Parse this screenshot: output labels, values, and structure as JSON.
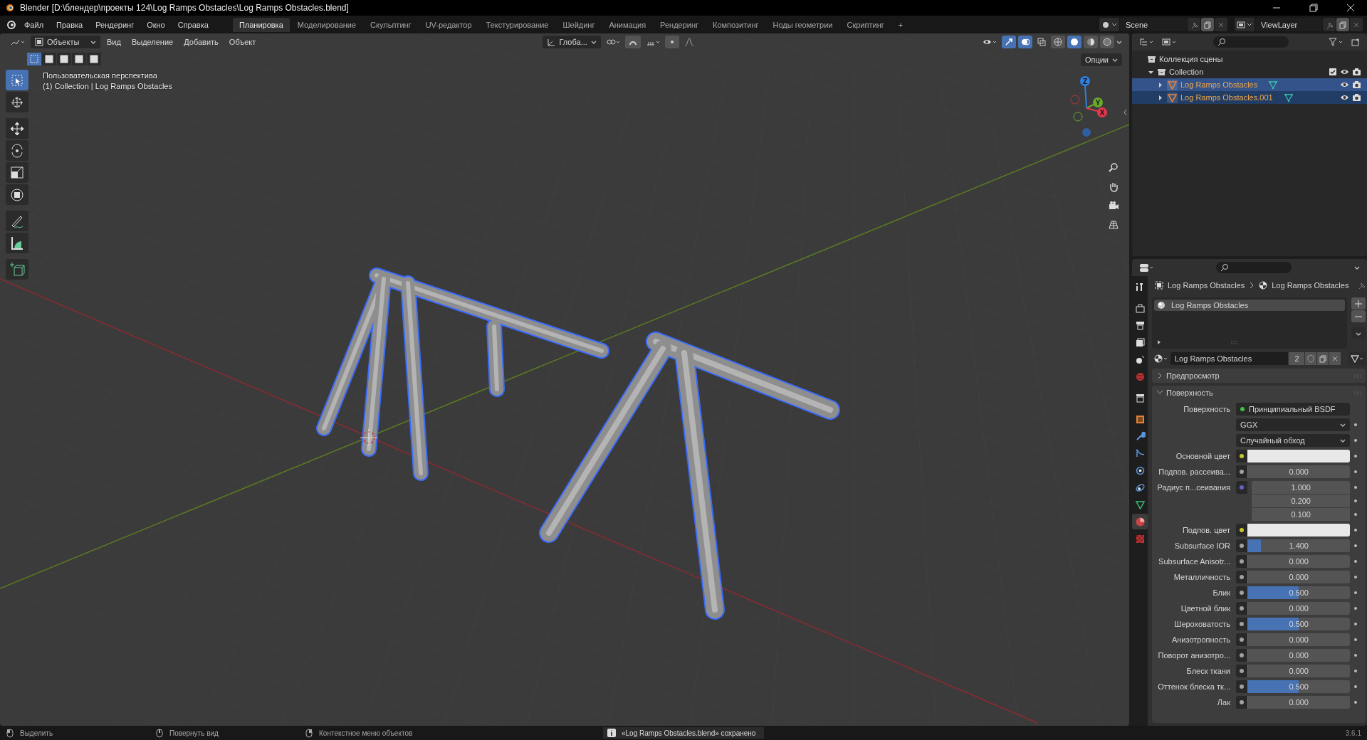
{
  "window": {
    "title": "Blender [D:\\блендер\\проекты 124\\Log Ramps Obstacles\\Log Ramps Obstacles.blend]"
  },
  "menu": [
    "Файл",
    "Правка",
    "Рендеринг",
    "Окно",
    "Справка"
  ],
  "workspace_tabs": [
    {
      "label": "Планировка",
      "selected": true
    },
    {
      "label": "Моделирование",
      "selected": false
    },
    {
      "label": "Скульптинг",
      "selected": false
    },
    {
      "label": "UV-редактор",
      "selected": false
    },
    {
      "label": "Текстурирование",
      "selected": false
    },
    {
      "label": "Шейдинг",
      "selected": false
    },
    {
      "label": "Анимация",
      "selected": false
    },
    {
      "label": "Рендеринг",
      "selected": false
    },
    {
      "label": "Композитинг",
      "selected": false
    },
    {
      "label": "Ноды геометрии",
      "selected": false
    },
    {
      "label": "Скриптинг",
      "selected": false
    }
  ],
  "add_tab": "+",
  "scene": {
    "scene_name": "Scene",
    "view_layer": "ViewLayer"
  },
  "viewport": {
    "mode": "Объекты",
    "menus": [
      "Вид",
      "Выделение",
      "Добавить",
      "Объект"
    ],
    "orientation": "Глоба...",
    "options": "Опции",
    "view_name": "Пользовательская перспектива",
    "object_info": "(1) Collection | Log Ramps Obstacles",
    "select_modes": [
      {
        "selected": true
      },
      {
        "selected": false
      },
      {
        "selected": false
      },
      {
        "selected": false
      },
      {
        "selected": false
      }
    ],
    "tools": [
      {
        "kind": "select",
        "selected": true
      },
      {
        "kind": "cursor",
        "selected": false
      },
      {
        "kind": "move",
        "selected": false
      },
      {
        "kind": "rotate",
        "selected": false
      },
      {
        "kind": "scale",
        "selected": false
      },
      {
        "kind": "transform",
        "selected": false
      },
      {
        "kind": "annotate",
        "selected": false
      },
      {
        "kind": "measure",
        "selected": false
      },
      {
        "kind": "add_cube",
        "selected": false
      }
    ],
    "gizmo_axes": [
      {
        "label": "Z",
        "color": "#2f7fe0"
      },
      {
        "label": "Y",
        "color": "#6aa82c"
      },
      {
        "label": "X",
        "color": "#e0384f"
      }
    ]
  },
  "outliner": {
    "tree": [
      {
        "label": "Коллекция сцены",
        "kind": "scene",
        "selected": false,
        "children": [
          {
            "label": "Collection",
            "kind": "collection",
            "selected": false,
            "expanded": true,
            "checked": true,
            "children": [
              {
                "label": "Log Ramps Obstacles",
                "kind": "mesh",
                "selected": true,
                "active": true,
                "expanded": false
              },
              {
                "label": "Log Ramps Obstacles.001",
                "kind": "mesh",
                "selected": true,
                "active": false,
                "expanded": false
              }
            ]
          }
        ]
      }
    ]
  },
  "properties": {
    "tabs": [
      {
        "kind": "tool",
        "selected": false
      },
      {
        "kind": "render",
        "selected": false
      },
      {
        "kind": "output",
        "selected": false
      },
      {
        "kind": "view_layer",
        "selected": false
      },
      {
        "kind": "scene",
        "selected": false
      },
      {
        "kind": "world",
        "selected": false
      },
      {
        "kind": "collection",
        "selected": false
      },
      {
        "kind": "object",
        "selected": false
      },
      {
        "kind": "modifier",
        "selected": false
      },
      {
        "kind": "particles",
        "selected": false
      },
      {
        "kind": "physics",
        "selected": false
      },
      {
        "kind": "constraints",
        "selected": false
      },
      {
        "kind": "data",
        "selected": false
      },
      {
        "kind": "material",
        "selected": true
      },
      {
        "kind": "texture",
        "selected": false
      }
    ],
    "breadcrumb": [
      "Log Ramps Obstacles",
      "Log Ramps Obstacles"
    ],
    "material_slots": [
      {
        "name": "Log Ramps Obstacles",
        "selected": true
      }
    ],
    "material": {
      "name": "Log Ramps Obstacles",
      "users": "2"
    },
    "panels": [
      {
        "title": "Предпросмотр",
        "expanded": false
      },
      {
        "title": "Поверхность",
        "expanded": true
      }
    ],
    "rows": [
      {
        "kind": "shader",
        "label": "Поверхность",
        "value": "Принципиальный BSDF",
        "socket": {
          "color": "#3fc03f"
        }
      },
      {
        "kind": "dropdown",
        "value": "GGX"
      },
      {
        "kind": "dropdown",
        "value": "Случайный обход"
      },
      {
        "kind": "color",
        "label": "Основной цвет",
        "color": "#e8e8e8",
        "socket": {
          "color": "#c7c729"
        }
      },
      {
        "kind": "value",
        "label": "Подпов. рассеива...",
        "value": "0.000",
        "level": 0,
        "socket": {
          "color": "#a1a1a1"
        }
      },
      {
        "kind": "vector",
        "label": "Радиус п...сеивания",
        "values": [
          "1.000",
          "0.200",
          "0.100"
        ],
        "socket": {
          "color": "#6363c7"
        }
      },
      {
        "kind": "color",
        "label": "Подпов. цвет",
        "color": "#e8e8e8",
        "socket": {
          "color": "#c7c729"
        }
      },
      {
        "kind": "value",
        "label": "Subsurface IOR",
        "value": "1.400",
        "level": 0.13,
        "socket": {
          "color": "#a1a1a1"
        }
      },
      {
        "kind": "value",
        "label": "Subsurface Anisotr...",
        "value": "0.000",
        "level": 0,
        "socket": {
          "color": "#a1a1a1"
        }
      },
      {
        "kind": "value",
        "label": "Металличность",
        "value": "0.000",
        "level": 0,
        "socket": {
          "color": "#a1a1a1"
        }
      },
      {
        "kind": "value",
        "label": "Блик",
        "value": "0.500",
        "level": 0.5,
        "socket": {
          "color": "#a1a1a1"
        }
      },
      {
        "kind": "value",
        "label": "Цветной блик",
        "value": "0.000",
        "level": 0,
        "socket": {
          "color": "#a1a1a1"
        }
      },
      {
        "kind": "value",
        "label": "Шероховатость",
        "value": "0.500",
        "level": 0.5,
        "socket": {
          "color": "#a1a1a1"
        }
      },
      {
        "kind": "value",
        "label": "Анизотропность",
        "value": "0.000",
        "level": 0,
        "socket": {
          "color": "#a1a1a1"
        }
      },
      {
        "kind": "value",
        "label": "Поворот анизотро...",
        "value": "0.000",
        "level": 0,
        "socket": {
          "color": "#a1a1a1"
        }
      },
      {
        "kind": "value",
        "label": "Блеск ткани",
        "value": "0.000",
        "level": 0,
        "socket": {
          "color": "#a1a1a1"
        }
      },
      {
        "kind": "value",
        "label": "Оттенок блеска тк...",
        "value": "0.500",
        "level": 0.5,
        "socket": {
          "color": "#a1a1a1"
        }
      },
      {
        "kind": "value",
        "label": "Лак",
        "value": "0.000",
        "level": 0,
        "socket": {
          "color": "#a1a1a1"
        }
      }
    ]
  },
  "status_bar": {
    "hints": [
      "Выделить",
      "Повернуть вид",
      "Контекстное меню объектов"
    ],
    "message": "«Log Ramps Obstacles.blend» сохранено",
    "version": "3.6.1"
  }
}
